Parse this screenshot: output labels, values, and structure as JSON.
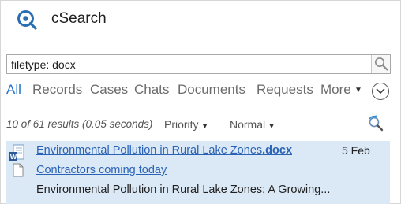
{
  "app": {
    "title": "cSearch"
  },
  "search": {
    "value": "filetype: docx"
  },
  "tabs": [
    {
      "label": "All",
      "active": true
    },
    {
      "label": "Records"
    },
    {
      "label": "Cases"
    },
    {
      "label": "Chats"
    },
    {
      "label": "Documents"
    },
    {
      "label": "Requests"
    },
    {
      "label": "More"
    }
  ],
  "results_info": {
    "status": "10 of 61 results (0.05 seconds)",
    "sort_by": "Priority",
    "sort_level": "Normal"
  },
  "results": [
    {
      "title": "Environmental Pollution in Rural Lake Zones",
      "extension": ".docx",
      "date": "5 Feb",
      "subtitle": "Contractors coming today",
      "snippet": "Environmental Pollution in Rural Lake Zones: A Growing..."
    }
  ],
  "colors": {
    "accent": "#2172c9",
    "link": "#2a63b5",
    "selected_row": "#dbe8f5"
  },
  "icons": {
    "logo": "search-logo-icon",
    "search": "magnifier-icon",
    "more": "chevron-down-circle-icon",
    "refresh": "refresh-search-icon",
    "word": "word-document-icon",
    "page": "page-icon"
  }
}
